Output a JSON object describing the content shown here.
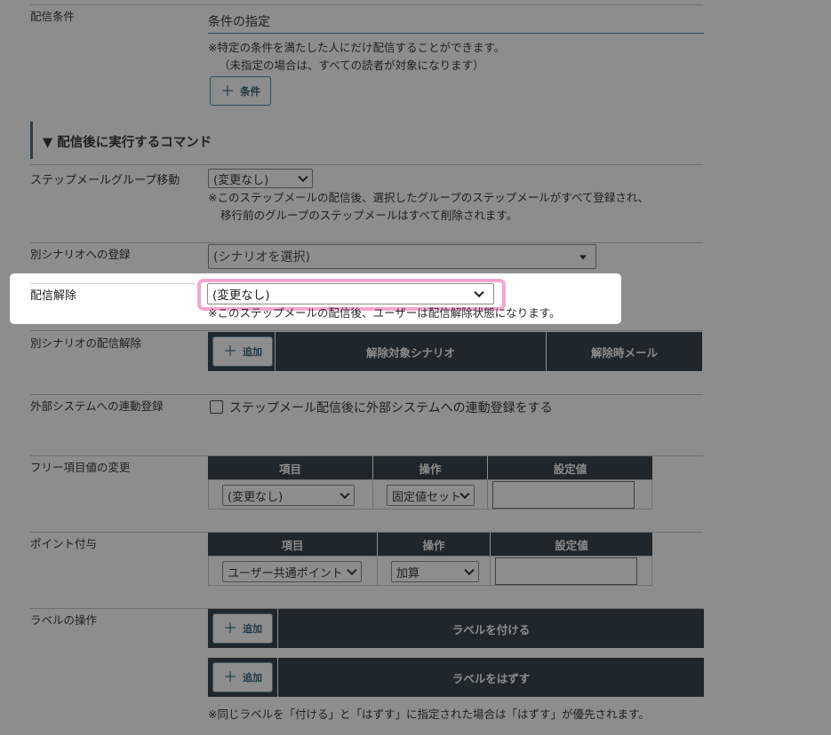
{
  "delivery_condition": {
    "label": "配信条件",
    "field_value": "条件の指定",
    "note_line1": "※特定の条件を満たした人にだけ配信することができます。",
    "note_line2": "（未指定の場合は、すべての読者が対象になります）",
    "add_button": "条件"
  },
  "section_title": "配信後に実行するコマンド",
  "section_marker": "▼",
  "step_group_move": {
    "label": "ステップメールグループ移動",
    "select_value": "(変更なし)",
    "note_line1": "※このステップメールの配信後、選択したグループのステップメールがすべて登録され、",
    "note_line2": "移行前のグループのステップメールはすべて削除されます。"
  },
  "other_scenario_register": {
    "label": "別シナリオへの登録",
    "select_value": "(シナリオを選択)"
  },
  "unsubscribe": {
    "label": "配信解除",
    "select_value": "(変更なし)",
    "note": "※このステップメールの配信後、ユーザーは配信解除状態になります。",
    "highlight_color": "#f4a6cf"
  },
  "other_scenario_unsubscribe": {
    "label": "別シナリオの配信解除",
    "add_button": "追加",
    "col_target": "解除対象シナリオ",
    "col_mail": "解除時メール"
  },
  "external_system": {
    "label": "外部システムへの連動登録",
    "checkbox_label": "ステップメール配信後に外部システムへの連動登録をする"
  },
  "free_item": {
    "label": "フリー項目値の変更",
    "col_item": "項目",
    "col_op": "操作",
    "col_value": "設定値",
    "item_value": "(変更なし)",
    "op_value": "固定値セット"
  },
  "points": {
    "label": "ポイント付与",
    "col_item": "項目",
    "col_op": "操作",
    "col_value": "設定値",
    "item_value": "ユーザー共通ポイント",
    "op_value": "加算"
  },
  "labels": {
    "label": "ラベルの操作",
    "add_button_1": "追加",
    "attach_text": "ラベルを付ける",
    "add_button_2": "追加",
    "detach_text": "ラベルをはずす",
    "note": "※同じラベルを「付ける」と「はずす」に指定された場合は「はずす」が優先されます。"
  },
  "colors": {
    "overlay": "#8d8d8d",
    "dark_header": "#1f272c",
    "accent_border": "#2e4d5c"
  }
}
